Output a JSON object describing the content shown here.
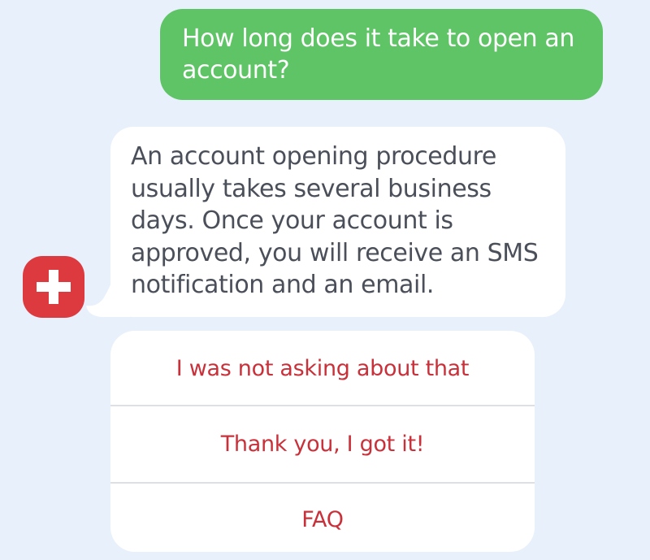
{
  "conversation": {
    "user_message": "How long does it take to open an account?",
    "bot_message": "An account opening procedure usually takes several business days. Once your account is approved, you will receive an SMS notification and an email.",
    "bot_avatar_icon": "red-cross-icon"
  },
  "quick_replies": [
    {
      "label": "I was not asking about that"
    },
    {
      "label": "Thank you, I got it!"
    },
    {
      "label": "FAQ"
    }
  ],
  "colors": {
    "background": "#e7f0fb",
    "user_bubble": "#5ec466",
    "bot_bubble": "#ffffff",
    "bot_text": "#4a4f59",
    "accent_red": "#dd3a3f",
    "reply_text": "#c9313a"
  }
}
